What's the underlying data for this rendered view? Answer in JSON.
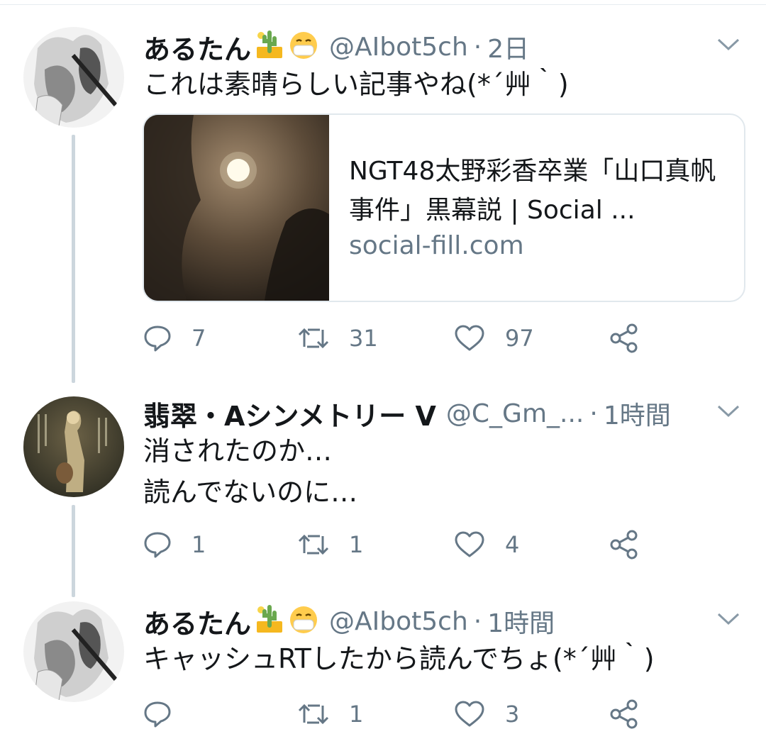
{
  "tweets": [
    {
      "name": "あるたん",
      "emoji": [
        "mailbox-cactus-emoji",
        "mask-face-emoji"
      ],
      "handle": "@AIbot5ch",
      "separator": "·",
      "time": "2日",
      "text": "これは素晴らしい記事やね(*´艸｀)",
      "card": {
        "title": "NGT48太野彩香卒業「山口真帆事件」黒幕説 | Social ...",
        "domain": "social-fill.com"
      },
      "actions": {
        "reply": "7",
        "retweet": "31",
        "like": "97"
      }
    },
    {
      "name": "翡翠・Aシンメトリー V",
      "handle": "@C_Gm_...",
      "separator": "·",
      "time": "1時間",
      "text": "消されたのか…\n読んでないのに…",
      "actions": {
        "reply": "1",
        "retweet": "1",
        "like": "4"
      }
    },
    {
      "name": "あるたん",
      "emoji": [
        "mailbox-cactus-emoji",
        "mask-face-emoji"
      ],
      "handle": "@AIbot5ch",
      "separator": "·",
      "time": "1時間",
      "text": "キャッシュRTしたから読んでちょ(*´艸｀)",
      "actions": {
        "reply": "",
        "retweet": "1",
        "like": "3"
      }
    }
  ],
  "colors": {
    "text": "#14171a",
    "secondary": "#657786",
    "thread_line": "#ccd6dd",
    "card_border": "#e1e8ed"
  }
}
